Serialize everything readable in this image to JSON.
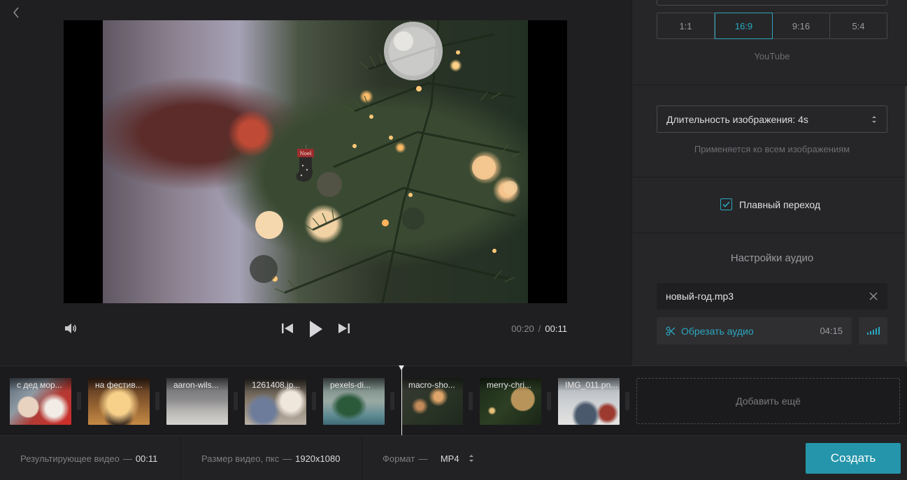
{
  "player": {
    "current_time": "00:20",
    "separator": "/",
    "duration": "00:11",
    "stocking_text": "Noel"
  },
  "settings": {
    "ratios": [
      {
        "label": "1:1",
        "active": false
      },
      {
        "label": "16:9",
        "active": true
      },
      {
        "label": "9:16",
        "active": false
      },
      {
        "label": "5:4",
        "active": false
      }
    ],
    "ratio_caption": "YouTube",
    "image_duration_label": "Длительность изображения: 4s",
    "image_duration_caption": "Применяется ко всем изображениям",
    "smooth_transition_label": "Плавный переход",
    "smooth_transition_checked": true,
    "audio_title": "Настройки аудио",
    "audio_file": "новый-год.mp3",
    "trim_audio_label": "Обрезать аудио",
    "trim_audio_duration": "04:15"
  },
  "timeline": {
    "clips": [
      {
        "name": "с дед мор..."
      },
      {
        "name": "на фестив..."
      },
      {
        "name": "aaron-wils..."
      },
      {
        "name": "1261408.jp..."
      },
      {
        "name": "pexels-di..."
      },
      {
        "name": "macro-sho..."
      },
      {
        "name": "merry-chri..."
      },
      {
        "name": "IMG_011.pn..."
      }
    ],
    "add_more_label": "Добавить ещё"
  },
  "bottom": {
    "result_label": "Результирующее видео",
    "result_value": "00:11",
    "size_label": "Размер видео, пкс",
    "size_value": "1920x1080",
    "format_label": "Формат",
    "format_value": "MP4",
    "dash": "—",
    "create_label": "Создать"
  },
  "colors": {
    "accent": "#2aa8bf",
    "button": "#2495aa",
    "background": "#1f1f21",
    "panel": "#262628"
  }
}
